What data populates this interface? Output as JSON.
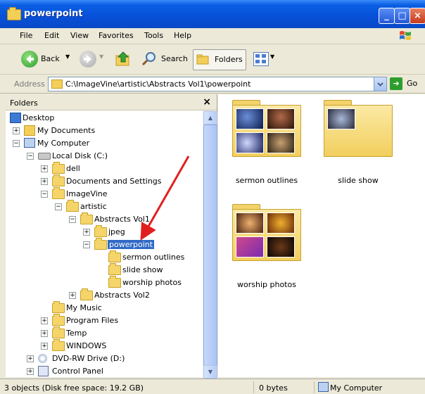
{
  "window": {
    "title": "powerpoint"
  },
  "menu": {
    "items": [
      "File",
      "Edit",
      "View",
      "Favorites",
      "Tools",
      "Help"
    ]
  },
  "toolbar": {
    "back_label": "Back",
    "search_label": "Search",
    "folders_label": "Folders"
  },
  "address": {
    "label": "Address",
    "value": "C:\\ImageVine\\artistic\\Abstracts Vol1\\powerpoint",
    "go_label": "Go"
  },
  "folder_pane": {
    "title": "Folders",
    "tree": [
      {
        "label": "Desktop"
      },
      {
        "label": "My Documents"
      },
      {
        "label": "My Computer"
      },
      {
        "label": "Local Disk (C:)"
      },
      {
        "label": "dell"
      },
      {
        "label": "Documents and Settings"
      },
      {
        "label": "ImageVine"
      },
      {
        "label": "artistic"
      },
      {
        "label": "Abstracts Vol1"
      },
      {
        "label": "jpeg"
      },
      {
        "label": "powerpoint"
      },
      {
        "label": "sermon outlines"
      },
      {
        "label": "slide show"
      },
      {
        "label": "worship photos"
      },
      {
        "label": "Abstracts Vol2"
      },
      {
        "label": "My Music"
      },
      {
        "label": "Program Files"
      },
      {
        "label": "Temp"
      },
      {
        "label": "WINDOWS"
      },
      {
        "label": "DVD-RW Drive (D:)"
      },
      {
        "label": "Control Panel"
      }
    ]
  },
  "content": {
    "folders": [
      {
        "label": "sermon outlines"
      },
      {
        "label": "slide show"
      },
      {
        "label": "worship photos"
      }
    ]
  },
  "status": {
    "objects": "3 objects (Disk free space: 19.2 GB)",
    "size": "0 bytes",
    "location": "My Computer"
  }
}
